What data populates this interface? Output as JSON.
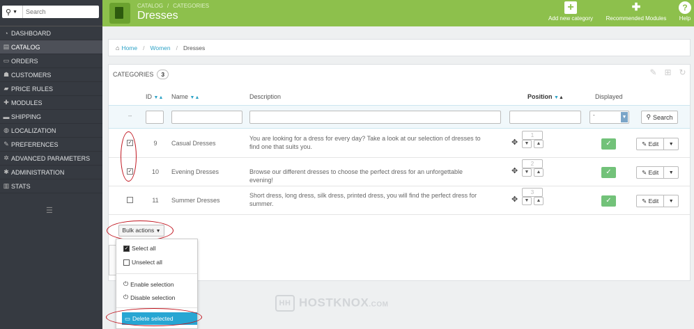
{
  "sidebar": {
    "search_placeholder": "Search",
    "items": [
      {
        "label": "DASHBOARD",
        "icon": "dashboard-icon",
        "glyph": "◔"
      },
      {
        "label": "CATALOG",
        "icon": "catalog-icon",
        "glyph": "▤"
      },
      {
        "label": "ORDERS",
        "icon": "orders-icon",
        "glyph": "▭"
      },
      {
        "label": "CUSTOMERS",
        "icon": "customers-icon",
        "glyph": "☗"
      },
      {
        "label": "PRICE RULES",
        "icon": "price-rules-icon",
        "glyph": "▰"
      },
      {
        "label": "MODULES",
        "icon": "modules-icon",
        "glyph": "✚"
      },
      {
        "label": "SHIPPING",
        "icon": "shipping-icon",
        "glyph": "▬"
      },
      {
        "label": "LOCALIZATION",
        "icon": "globe-icon",
        "glyph": "◍"
      },
      {
        "label": "PREFERENCES",
        "icon": "wrench-icon",
        "glyph": "✎"
      },
      {
        "label": "ADVANCED PARAMETERS",
        "icon": "cogs-icon",
        "glyph": "✲"
      },
      {
        "label": "ADMINISTRATION",
        "icon": "admin-icon",
        "glyph": "✱"
      },
      {
        "label": "STATS",
        "icon": "stats-icon",
        "glyph": "▥"
      }
    ],
    "active_index": 1
  },
  "header": {
    "crumb_section": "CATALOG",
    "crumb_page": "CATEGORIES",
    "title": "Dresses",
    "buttons": [
      {
        "label": "Add new category",
        "icon": "plus-icon"
      },
      {
        "label": "Recommended Modules",
        "icon": "puzzle-icon"
      },
      {
        "label": "Help",
        "icon": "help-icon"
      }
    ]
  },
  "breadcrumb": {
    "home": "Home",
    "level1": "Women",
    "current": "Dresses"
  },
  "panel": {
    "title": "CATEGORIES",
    "count": "3",
    "columns": {
      "id": "ID",
      "name": "Name",
      "description": "Description",
      "position": "Position",
      "displayed": "Displayed"
    },
    "filter": {
      "dashes": "--",
      "displayed_value": "-",
      "search_label": "Search"
    },
    "rows": [
      {
        "checked": true,
        "id": "9",
        "name": "Casual Dresses",
        "description": "You are looking for a dress for every day? Take a look at our selection of dresses to find one that suits you.",
        "position": "1",
        "edit": "Edit"
      },
      {
        "checked": true,
        "id": "10",
        "name": "Evening Dresses",
        "description": "Browse our different dresses to choose the perfect dress for an unforgettable evening!",
        "position": "2",
        "edit": "Edit"
      },
      {
        "checked": false,
        "id": "11",
        "name": "Summer Dresses",
        "description": "Short dress, long dress, silk dress, printed dress, you will find the perfect dress for summer.",
        "position": "3",
        "edit": "Edit"
      }
    ]
  },
  "bulk": {
    "button": "Bulk actions",
    "select_all": "Select all",
    "unselect_all": "Unselect all",
    "enable": "Enable selection",
    "disable": "Disable selection",
    "delete": "Delete selected"
  },
  "watermark": {
    "logo": "HH",
    "text": "HOSTKNOX",
    "suffix": ".COM"
  },
  "colors": {
    "header_green": "#8dc04c",
    "sidebar_dark": "#363a41",
    "link_blue": "#2ea3c7",
    "status_green": "#72c279",
    "annotation_red": "#c0141e",
    "delete_blue": "#27a6d3"
  }
}
